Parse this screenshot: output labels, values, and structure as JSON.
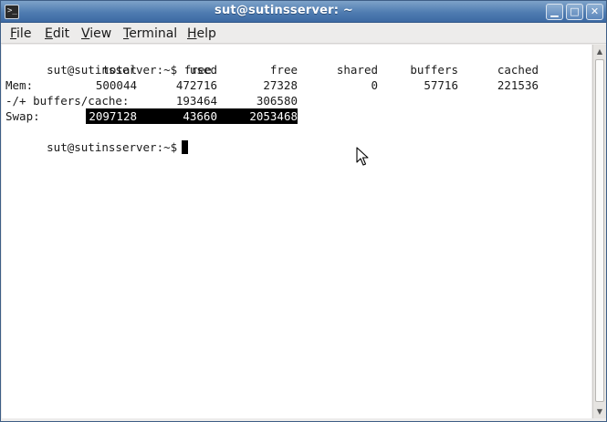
{
  "window": {
    "title": "sut@sutinsserver: ~",
    "icon": "terminal-icon",
    "controls": {
      "minimize": "▁",
      "maximize": "□",
      "close": "✕"
    }
  },
  "menubar": {
    "file": {
      "u": "F",
      "rest": "ile"
    },
    "edit": {
      "u": "E",
      "rest": "dit"
    },
    "view": {
      "u": "V",
      "rest": "iew"
    },
    "terminal": {
      "u": "T",
      "rest": "erminal"
    },
    "help": {
      "u": "H",
      "rest": "elp"
    }
  },
  "terminal": {
    "prompt": "sut@sutinsserver:~$",
    "command": "free",
    "headers": [
      "total",
      "used",
      "free",
      "shared",
      "buffers",
      "cached"
    ],
    "mem": {
      "label": "Mem:",
      "total": "500044",
      "used": "472716",
      "free": "27328",
      "shared": "0",
      "buffers": "57716",
      "cached": "221536"
    },
    "bufcache": {
      "label": "-/+ buffers/cache:",
      "used": "193464",
      "free": "306580"
    },
    "swap": {
      "label": "Swap:",
      "total": "2097128",
      "used": "43660",
      "free": "2053468"
    },
    "second_prompt": "sut@sutinsserver:~$"
  },
  "scrollbar": {
    "up": "▲",
    "down": "▼"
  }
}
